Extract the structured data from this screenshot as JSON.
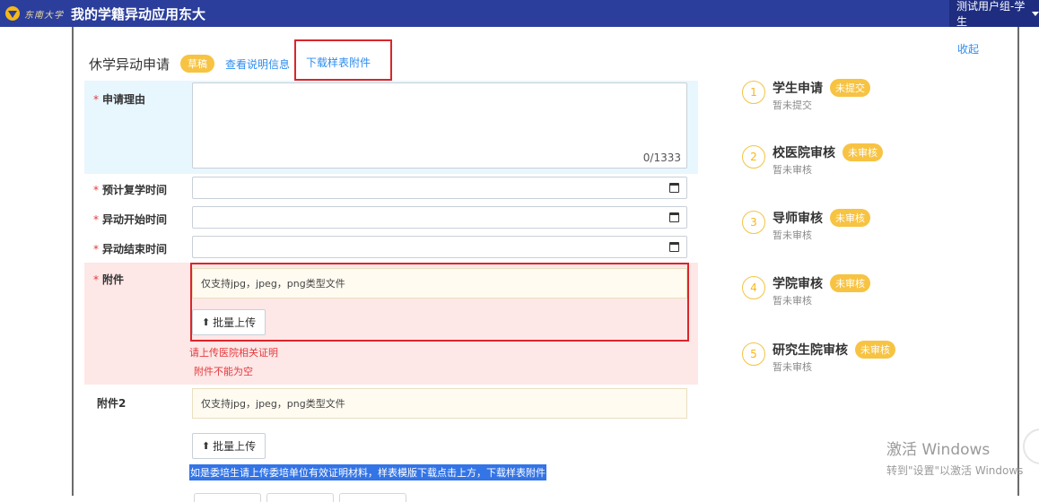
{
  "header": {
    "logo_text": "东南大学",
    "app_title": "我的学籍异动应用东大",
    "user_label": "测试用户组-学生"
  },
  "card": {
    "collapse": "收起",
    "title": "休学异动申请",
    "status": "草稿",
    "view_info": "查看说明信息",
    "download_sample": "下载样表附件"
  },
  "form": {
    "reason_label": "申请理由",
    "reason_counter": "0/1333",
    "return_time_label": "预计复学时间",
    "start_time_label": "异动开始时间",
    "end_time_label": "异动结束时间",
    "attach1_label": "附件",
    "attach1_hint": "仅支持jpg，jpeg，png类型文件",
    "upload_label": "批量上传",
    "attach1_error_1": "请上传医院相关证明",
    "attach1_error_2": "附件不能为空",
    "attach2_label": "附件2",
    "attach2_hint": "仅支持jpg，jpeg，png类型文件",
    "attach2_note": "如是委培生请上传委培单位有效证明材料，样表模版下载点击上方，下载样表附件"
  },
  "steps": [
    {
      "num": "1",
      "title": "学生申请",
      "badge": "未提交",
      "sub": "暂未提交"
    },
    {
      "num": "2",
      "title": "校医院审核",
      "badge": "未审核",
      "sub": "暂未审核"
    },
    {
      "num": "3",
      "title": "导师审核",
      "badge": "未审核",
      "sub": "暂未审核"
    },
    {
      "num": "4",
      "title": "学院审核",
      "badge": "未审核",
      "sub": "暂未审核"
    },
    {
      "num": "5",
      "title": "研究生院审核",
      "badge": "未审核",
      "sub": "暂未审核"
    }
  ],
  "watermark": {
    "line1": "激活 Windows",
    "line2": "转到\"设置\"以激活 Windows"
  },
  "colors": {
    "topbar": "#2b3e9c",
    "accent_link": "#2d8cf0",
    "badge": "#f7c342",
    "error": "#e4393c",
    "highlight_border": "#d9262c"
  }
}
